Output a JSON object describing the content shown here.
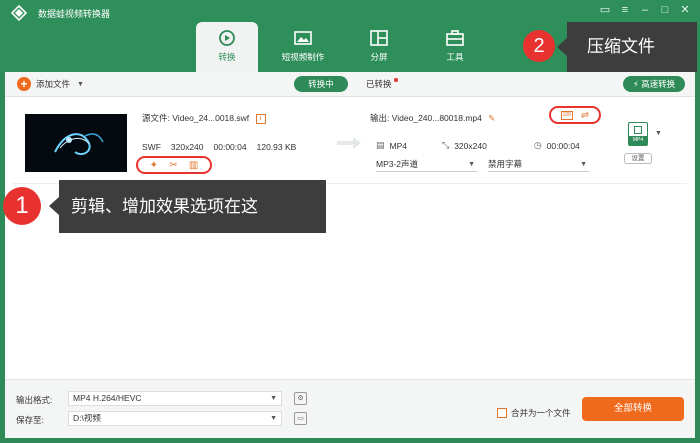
{
  "window": {
    "title": "数据蛙视频转换器",
    "controls": [
      "chat-icon",
      "menu-icon",
      "minimize-icon",
      "maximize-icon",
      "close-icon"
    ]
  },
  "nav_tabs": [
    {
      "label": "转换",
      "icon": "convert-icon",
      "active": true
    },
    {
      "label": "短视频制作",
      "icon": "photo-icon",
      "active": false
    },
    {
      "label": "分屏",
      "icon": "split-screen-icon",
      "active": false
    },
    {
      "label": "工具",
      "icon": "toolbox-icon",
      "active": false
    }
  ],
  "toolbar": {
    "add_file_label": "添加文件",
    "tab_converting": "转换中",
    "tab_converted": "已转换",
    "high_speed_label": "高速转换"
  },
  "file_item": {
    "source_label": "源文件:",
    "source_name": "Video_24...0018.swf",
    "source_format": "SWF",
    "source_resolution": "320x240",
    "source_duration": "00:00:04",
    "source_size": "120.93 KB",
    "output_label": "输出:",
    "output_name": "Video_240...80018.mp4",
    "output_format": "MP4",
    "output_resolution": "320x240",
    "output_duration": "00:00:04",
    "audio_track": "MP3-2声道",
    "subtitle": "禁用字幕",
    "format_badge": "MP4",
    "settings_label": "设置"
  },
  "callouts": {
    "one_number": "1",
    "one_text": "剪辑、增加效果选项在这",
    "two_number": "2",
    "two_text": "压缩文件"
  },
  "footer": {
    "output_format_label": "输出格式:",
    "output_format_value": "MP4 H.264/HEVC",
    "save_to_label": "保存至:",
    "save_to_value": "D:\\视频",
    "merge_label": "合并为一个文件",
    "convert_all_label": "全部转换"
  },
  "colors": {
    "brand_green": "#2e8b57",
    "accent_orange": "#f06a1d",
    "callout_red": "#e8322f",
    "callout_box": "#3d3d3d"
  }
}
